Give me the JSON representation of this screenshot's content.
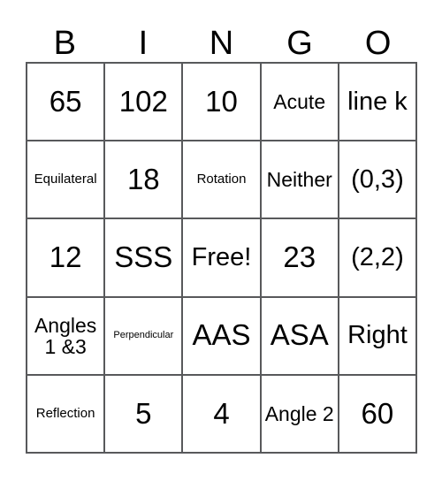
{
  "card": {
    "title": "BINGO Card",
    "headers": [
      "B",
      "I",
      "N",
      "G",
      "O"
    ],
    "rows": [
      [
        {
          "text": "65",
          "size": "fs-xl"
        },
        {
          "text": "102",
          "size": "fs-xl"
        },
        {
          "text": "10",
          "size": "fs-xl"
        },
        {
          "text": "Acute",
          "size": "fs-md"
        },
        {
          "text": "line k",
          "size": "fs-lg"
        }
      ],
      [
        {
          "text": "Equilateral",
          "size": "fs-sm"
        },
        {
          "text": "18",
          "size": "fs-xl"
        },
        {
          "text": "Rotation",
          "size": "fs-sm"
        },
        {
          "text": "Neither",
          "size": "fs-md"
        },
        {
          "text": "(0,3)",
          "size": "fs-lg"
        }
      ],
      [
        {
          "text": "12",
          "size": "fs-xl"
        },
        {
          "text": "SSS",
          "size": "fs-xl"
        },
        {
          "text": "Free!",
          "size": "fs-lg"
        },
        {
          "text": "23",
          "size": "fs-xl"
        },
        {
          "text": "(2,2)",
          "size": "fs-lg"
        }
      ],
      [
        {
          "text": "Angles 1 &3",
          "size": "fs-md"
        },
        {
          "text": "Perpendicular",
          "size": "fs-xs"
        },
        {
          "text": "AAS",
          "size": "fs-xl"
        },
        {
          "text": "ASA",
          "size": "fs-xl"
        },
        {
          "text": "Right",
          "size": "fs-lg"
        }
      ],
      [
        {
          "text": "Reflection",
          "size": "fs-sm"
        },
        {
          "text": "5",
          "size": "fs-xl"
        },
        {
          "text": "4",
          "size": "fs-xl"
        },
        {
          "text": "Angle 2",
          "size": "fs-md"
        },
        {
          "text": "60",
          "size": "fs-xl"
        }
      ]
    ],
    "colors": {
      "border": "#58595b",
      "background": "#ffffff",
      "text": "#000000"
    }
  }
}
